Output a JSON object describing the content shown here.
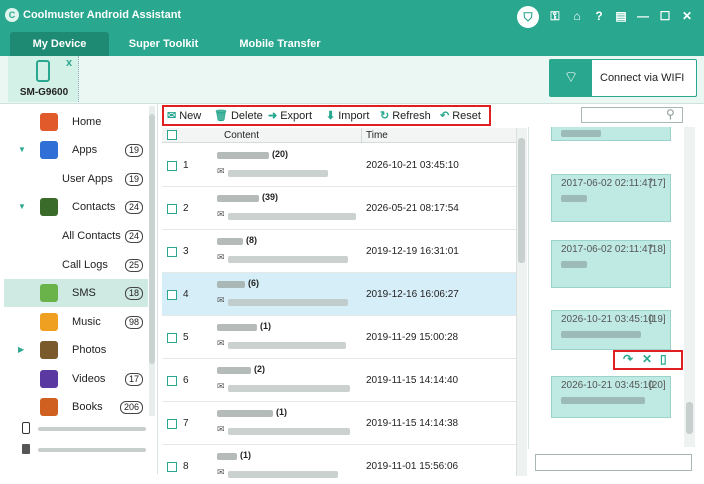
{
  "app": {
    "title": "Coolmuster Android Assistant",
    "accent": "#2aa88f",
    "logo_letter": "C"
  },
  "title_icons": [
    "shop-cart-icon",
    "key-icon",
    "home-icon",
    "help-icon",
    "feedback-icon",
    "minimize-icon",
    "maximize-icon",
    "close-icon"
  ],
  "title_glyphs": {
    "cart": "⛉",
    "key": "⚿",
    "home": "⌂",
    "help": "?",
    "feedback": "▤",
    "minimize": "—",
    "maximize": "☐",
    "close": "✕"
  },
  "tabs": [
    {
      "label": "My Device",
      "active": true
    },
    {
      "label": "Super Toolkit",
      "active": false
    },
    {
      "label": "Mobile Transfer",
      "active": false
    }
  ],
  "device": {
    "name": "SM-G9600",
    "close_glyph": "x"
  },
  "wifi": {
    "label": "Connect via WIFI",
    "glyph": "⌔"
  },
  "sidebar": {
    "items": [
      {
        "label": "Home",
        "badge": "",
        "arrow": "",
        "icon": "home-icon",
        "color": "#e05a2b"
      },
      {
        "label": "Apps",
        "badge": "19",
        "arrow": "▼",
        "icon": "apps-icon",
        "color": "#2f6fd6"
      },
      {
        "label": "User Apps",
        "badge": "19",
        "arrow": "",
        "icon": "",
        "color": ""
      },
      {
        "label": "Contacts",
        "badge": "24",
        "arrow": "▼",
        "icon": "contacts-icon",
        "color": "#3a6b2a"
      },
      {
        "label": "All Contacts",
        "badge": "24",
        "arrow": "",
        "icon": "",
        "color": ""
      },
      {
        "label": "Call Logs",
        "badge": "25",
        "arrow": "",
        "icon": "",
        "color": ""
      },
      {
        "label": "SMS",
        "badge": "18",
        "arrow": "",
        "icon": "sms-icon",
        "color": "#6ab34a",
        "selected": true
      },
      {
        "label": "Music",
        "badge": "98",
        "arrow": "",
        "icon": "music-icon",
        "color": "#f0a020"
      },
      {
        "label": "Photos",
        "badge": "",
        "arrow": "▶",
        "icon": "photos-icon",
        "color": "#7a5a2a"
      },
      {
        "label": "Videos",
        "badge": "17",
        "arrow": "",
        "icon": "videos-icon",
        "color": "#5a3aa0"
      },
      {
        "label": "Books",
        "badge": "206",
        "arrow": "",
        "icon": "books-icon",
        "color": "#d06020"
      }
    ]
  },
  "toolbar": {
    "new": "New",
    "delete": "Delete",
    "export": "Export",
    "import": "Import",
    "refresh": "Refresh",
    "reset": "Reset",
    "glyphs": {
      "new": "✉",
      "delete": "🗑",
      "export": "➜",
      "import": "⬇",
      "refresh": "↻",
      "reset": "↶"
    }
  },
  "table": {
    "headers": {
      "content": "Content",
      "time": "Time"
    },
    "rows": [
      {
        "num": "1",
        "count": "(20)",
        "time": "2026-10-21 03:45:10"
      },
      {
        "num": "2",
        "count": "(39)",
        "time": "2026-05-21 08:17:54"
      },
      {
        "num": "3",
        "count": "(8)",
        "time": "2019-12-19 16:31:01"
      },
      {
        "num": "4",
        "count": "(6)",
        "time": "2019-12-16 16:06:27",
        "selected": true
      },
      {
        "num": "5",
        "count": "(1)",
        "time": "2019-11-29 15:00:28"
      },
      {
        "num": "6",
        "count": "(2)",
        "time": "2019-11-15 14:14:40"
      },
      {
        "num": "7",
        "count": "(1)",
        "time": "2019-11-15 14:14:38"
      },
      {
        "num": "8",
        "count": "(1)",
        "time": "2019-11-01 15:56:06"
      }
    ]
  },
  "conversation": {
    "messages": [
      {
        "date": "",
        "index": ""
      },
      {
        "date": "2017-06-02 02:11:47",
        "index": "[17]"
      },
      {
        "date": "2017-06-02 02:11:47",
        "index": "[18]"
      },
      {
        "date": "2026-10-21 03:45:10",
        "index": "[19]"
      },
      {
        "date": "2026-10-21 03:45:10",
        "index": "[20]"
      }
    ],
    "actions": {
      "forward": "↷",
      "delete": "✕",
      "copy": "▯"
    }
  }
}
